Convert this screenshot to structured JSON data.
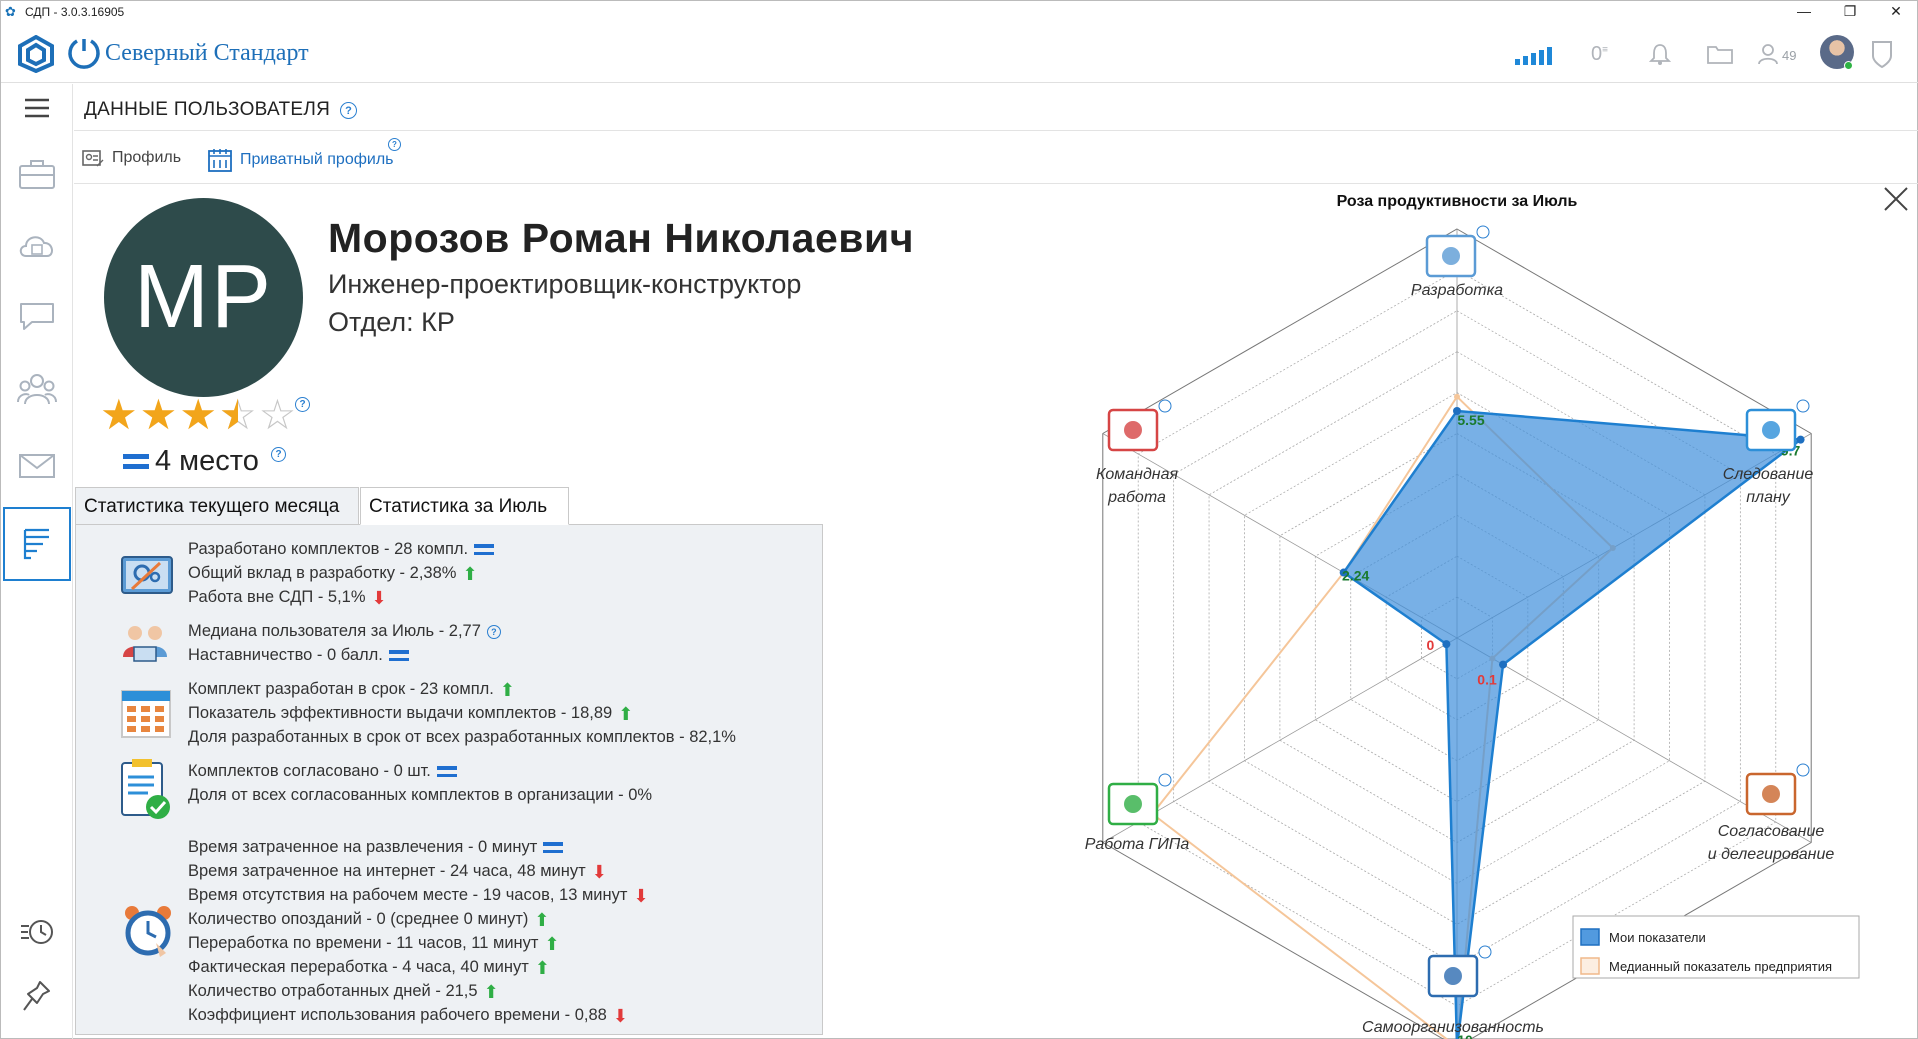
{
  "window": {
    "title": "СДП - 3.0.3.16905",
    "minimize": "—",
    "restore": "❐",
    "close": "✕"
  },
  "brand": {
    "name": "Северный Стандарт"
  },
  "header": {
    "zero_count": "0",
    "users_count": "49"
  },
  "page": {
    "title": "ДАННЫЕ ПОЛЬЗОВАТЕЛЯ",
    "help": "?"
  },
  "profile_tabs": {
    "profile": "Профиль",
    "private": "Приватный профиль",
    "help": "?"
  },
  "user": {
    "initials": "МР",
    "full_name": "Морозов Роман Николаевич",
    "position": "Инженер-проектировщик-конструктор",
    "department": "Отдел: КР",
    "rating": 3.5,
    "rating_max": 5,
    "place": "4 место",
    "help": "?"
  },
  "stats_tabs": {
    "current": "Статистика текущего месяца",
    "july": "Статистика за Июль"
  },
  "stats": {
    "development": [
      {
        "text": "Разработано комплектов - 28 компл.",
        "trend": "eq"
      },
      {
        "text": "Общий вклад в разработку - 2,38%",
        "trend": "up"
      },
      {
        "text": "Работа вне СДП - 5,1%",
        "trend": "down"
      }
    ],
    "team": [
      {
        "text": "Медиана пользователя за Июль -  2,77",
        "trend": "help"
      },
      {
        "text": "Наставничество - 0 балл.",
        "trend": "eq"
      }
    ],
    "plan": [
      {
        "text": "Комплект разработан в срок - 23 компл.",
        "trend": "up"
      },
      {
        "text": "Показатель эффективности выдачи комплектов - 18,89",
        "trend": "up"
      },
      {
        "text": "Доля разработанных в срок от всех разработанных комплектов - 82,1%",
        "trend": "none"
      }
    ],
    "approval": [
      {
        "text": "Комплектов согласовано - 0 шт.",
        "trend": "eq"
      },
      {
        "text": "Доля от всех согласованных комплектов в организации - 0%",
        "trend": "none"
      }
    ],
    "time": [
      {
        "text": "Время затраченное на развлечения - 0 минут",
        "trend": "eq"
      },
      {
        "text": "Время затраченное на интернет - 24 часа, 48 минут",
        "trend": "down"
      },
      {
        "text": "Время отсутствия на рабочем месте - 19 часов, 13 минут",
        "trend": "down"
      },
      {
        "text": "Количество опозданий - 0 (среднее 0 минут)",
        "trend": "up"
      },
      {
        "text": "Переработка по времени - 11 часов, 11 минут",
        "trend": "up"
      },
      {
        "text": "Фактическая переработка - 4 часа, 40 минут",
        "trend": "up"
      },
      {
        "text": "Количество отработанных дней - 21,5",
        "trend": "up"
      },
      {
        "text": "Коэффициент использования рабочего времени - 0,88",
        "trend": "down"
      }
    ]
  },
  "chart_data": {
    "type": "radar",
    "title": "Роза продуктивности за Июль",
    "max": 10,
    "axes": [
      {
        "label_lines": [
          "Разработка"
        ]
      },
      {
        "label_lines": [
          "Следование",
          "плану"
        ]
      },
      {
        "label_lines": [
          "Согласование",
          "и делегирование"
        ]
      },
      {
        "label_lines": [
          "Самоорганизованность"
        ]
      },
      {
        "label_lines": [
          "Работа ГИПа"
        ]
      },
      {
        "label_lines": [
          "Командная",
          "работа"
        ]
      }
    ],
    "series": [
      {
        "name": "Мои показатели",
        "values": [
          5.55,
          9.7,
          1.3,
          10,
          0.3,
          3.2
        ],
        "value_labels": [
          "5.55",
          "9.7",
          "0.1",
          "10",
          "0",
          "2.24"
        ],
        "color": "#3f8fdc"
      },
      {
        "name": "Медианный показатель предприятия",
        "values": [
          5.9,
          4.4,
          1.0,
          10,
          8.6,
          3.2
        ],
        "color": "#f5c69a"
      }
    ],
    "legend_position": "bottom-right"
  },
  "colors": {
    "accent": "#1e7fd0",
    "avatar_bg": "#2e4b4b",
    "star": "#f2a51b",
    "up": "#2fae45",
    "down": "#e23a3a"
  }
}
